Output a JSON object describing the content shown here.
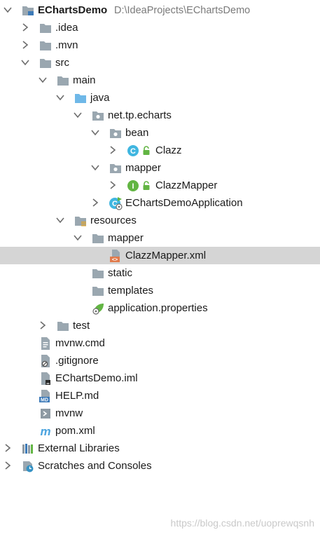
{
  "project": {
    "name": "EChartsDemo",
    "path": "D:\\IdeaProjects\\EChartsDemo"
  },
  "tree": [
    {
      "label": "EChartsDemo",
      "icon": "project-folder-icon",
      "arrow": "down",
      "bold": true
    },
    {
      "label": ".idea",
      "icon": "folder-icon",
      "arrow": "right"
    },
    {
      "label": ".mvn",
      "icon": "folder-icon",
      "arrow": "right"
    },
    {
      "label": "src",
      "icon": "folder-icon",
      "arrow": "down"
    },
    {
      "label": "main",
      "icon": "folder-icon",
      "arrow": "down"
    },
    {
      "label": "java",
      "icon": "source-folder-icon",
      "arrow": "down"
    },
    {
      "label": "net.tp.echarts",
      "icon": "package-icon",
      "arrow": "down"
    },
    {
      "label": "bean",
      "icon": "package-icon",
      "arrow": "down"
    },
    {
      "label": "Clazz",
      "icon": "class-icon",
      "arrow": "right",
      "lock": true
    },
    {
      "label": "mapper",
      "icon": "package-icon",
      "arrow": "down"
    },
    {
      "label": "ClazzMapper",
      "icon": "interface-icon",
      "arrow": "right",
      "lock": true
    },
    {
      "label": "EChartsDemoApplication",
      "icon": "spring-boot-class-icon",
      "arrow": "right"
    },
    {
      "label": "resources",
      "icon": "resources-folder-icon",
      "arrow": "down"
    },
    {
      "label": "mapper",
      "icon": "folder-icon",
      "arrow": "down"
    },
    {
      "label": "ClazzMapper.xml",
      "icon": "xml-file-icon",
      "selected": true
    },
    {
      "label": "static",
      "icon": "folder-icon"
    },
    {
      "label": "templates",
      "icon": "folder-icon"
    },
    {
      "label": "application.properties",
      "icon": "spring-properties-icon"
    },
    {
      "label": "test",
      "icon": "folder-icon",
      "arrow": "right"
    },
    {
      "label": "mvnw.cmd",
      "icon": "text-file-icon"
    },
    {
      "label": ".gitignore",
      "icon": "gitignore-file-icon"
    },
    {
      "label": "EChartsDemo.iml",
      "icon": "iml-file-icon"
    },
    {
      "label": "HELP.md",
      "icon": "markdown-file-icon"
    },
    {
      "label": "mvnw",
      "icon": "shell-script-icon"
    },
    {
      "label": "pom.xml",
      "icon": "maven-icon"
    },
    {
      "label": "External Libraries",
      "icon": "libraries-icon",
      "arrow": "right"
    },
    {
      "label": "Scratches and Consoles",
      "icon": "scratches-icon",
      "arrow": "right"
    }
  ],
  "watermark": "https://blog.csdn.net/uoprewqsnh",
  "colors": {
    "selection": "#d5d5d5",
    "folder": "#9aa7b0",
    "source_folder": "#6fb8e8",
    "class": "#40b6e0",
    "interface": "#62b543",
    "lock": "#62b543",
    "xml": "#e07a4b"
  }
}
